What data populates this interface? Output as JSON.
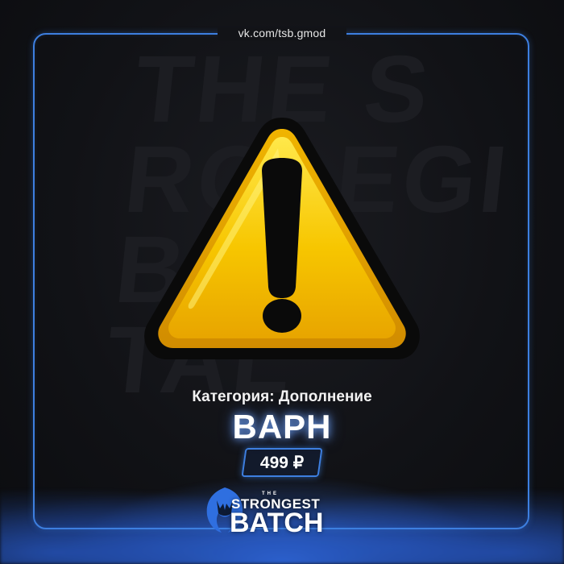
{
  "header": {
    "url": "vk.com/tsb.gmod"
  },
  "product": {
    "category": "Категория: Дополнение",
    "title": "BAPH",
    "price": "499 ₽"
  },
  "logo": {
    "the": "THE",
    "line1": "STRONGEST",
    "line2": "BATCH"
  },
  "icons": {
    "main": "warning-triangle-icon",
    "emblem": "batch-emblem-icon"
  },
  "colors": {
    "accent": "#3d7fe0",
    "warning_yellow": "#f5c400",
    "background": "#111216"
  }
}
